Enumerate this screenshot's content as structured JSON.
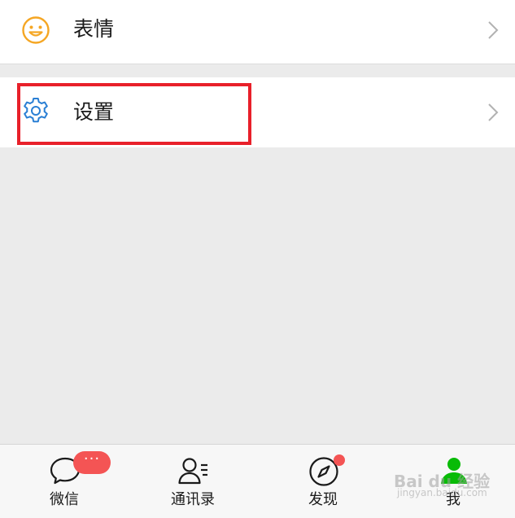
{
  "list": {
    "emoji_item": {
      "label": "表情",
      "icon": "smiley-icon",
      "icon_color": "#f5a623"
    },
    "settings_item": {
      "label": "设置",
      "icon": "gear-icon",
      "icon_color": "#2a7fd4"
    }
  },
  "annotation": {
    "highlight_color": "#e8202a"
  },
  "tabbar": {
    "tabs": [
      {
        "label": "微信",
        "icon": "chat-bubble-icon",
        "badge": "···"
      },
      {
        "label": "通讯录",
        "icon": "contacts-icon"
      },
      {
        "label": "发现",
        "icon": "compass-icon"
      },
      {
        "label": "我",
        "icon": "person-icon",
        "active": true
      }
    ],
    "active_color": "#09bb07",
    "badge_color": "#f45454"
  },
  "watermark": {
    "main": "Bai du 经验",
    "sub": "jingyan.baidu.com"
  }
}
